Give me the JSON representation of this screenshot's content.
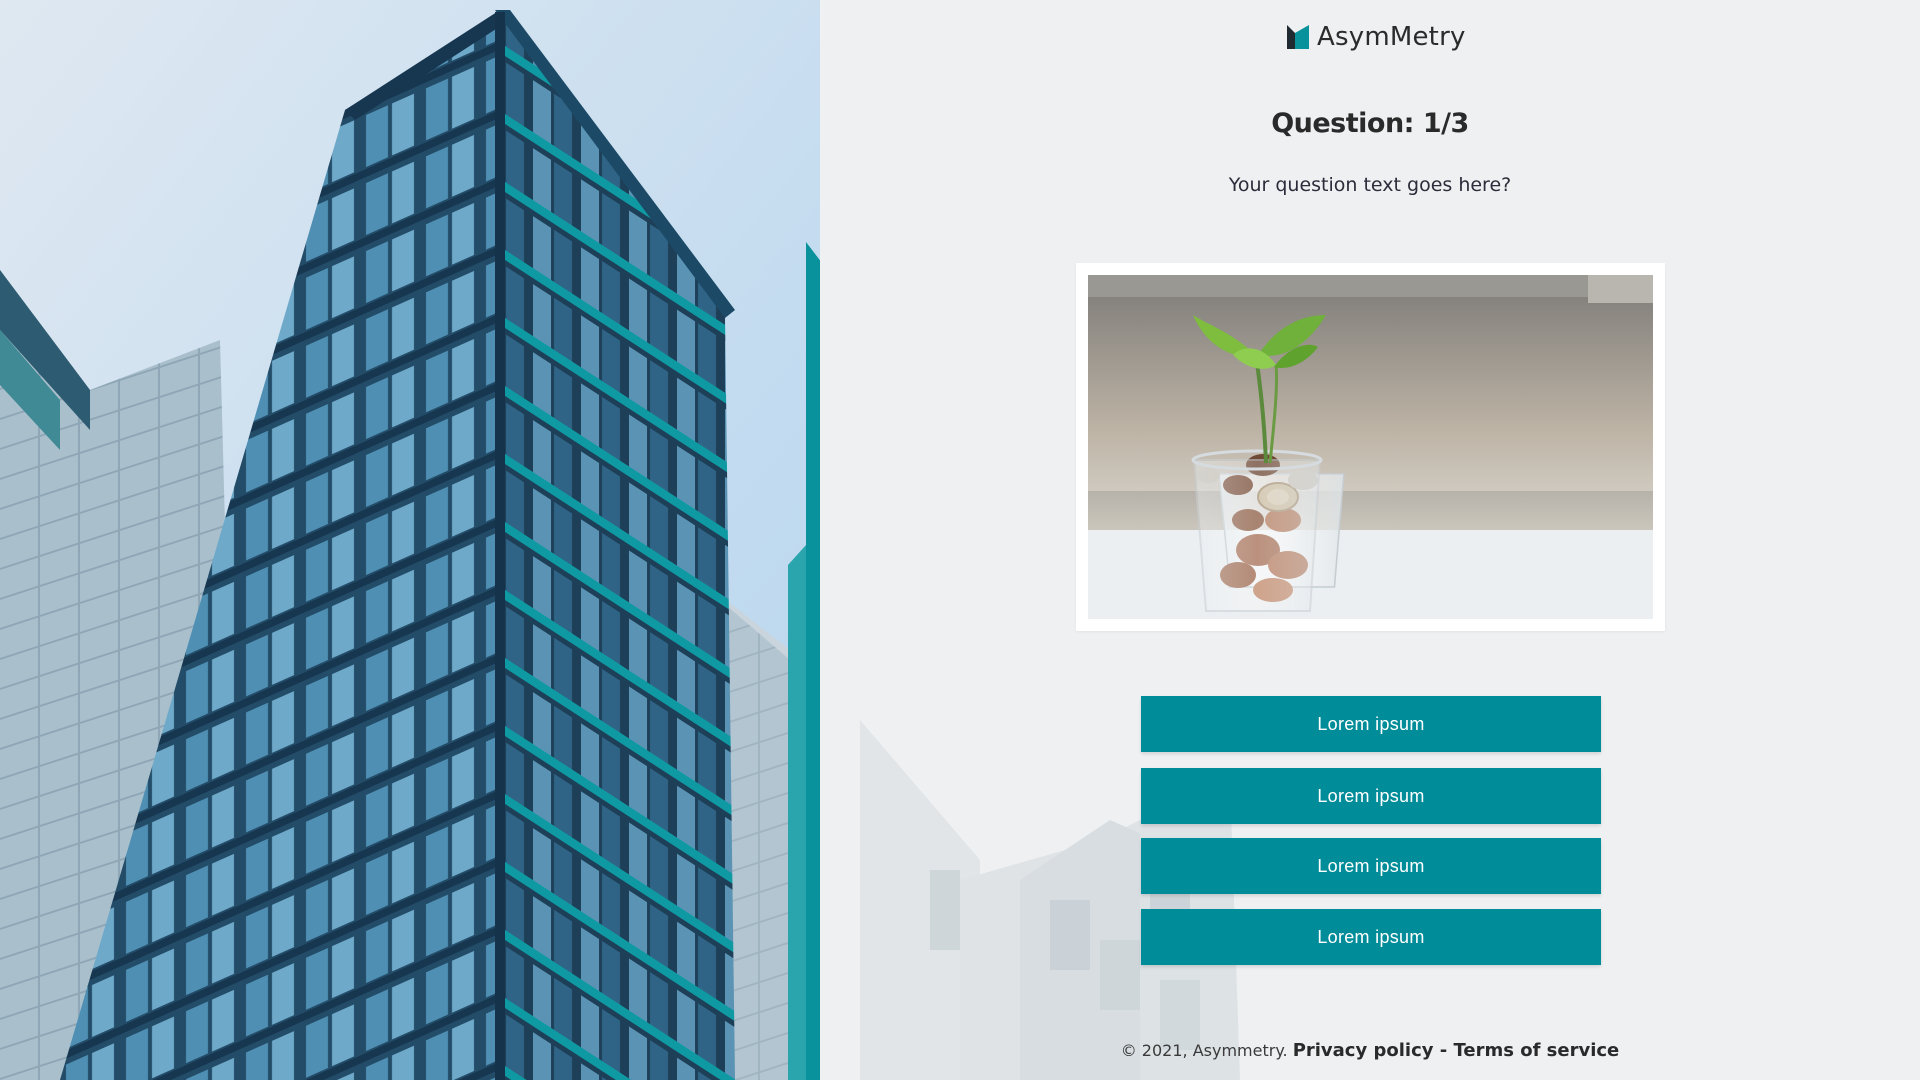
{
  "brand": {
    "name": "AsymMetry",
    "logo_icon": "asymmetry-logo-mark",
    "accent_color": "#008c99"
  },
  "quiz": {
    "title": "Question: 1/3",
    "question_text": "Your question text goes here?",
    "image_icon": "plant-in-coins-jar",
    "answers": [
      {
        "label": "Lorem ipsum"
      },
      {
        "label": "Lorem ipsum"
      },
      {
        "label": "Lorem ipsum"
      },
      {
        "label": "Lorem ipsum"
      }
    ]
  },
  "footer": {
    "copyright": "© 2021, Asymmetry.",
    "privacy_link": "Privacy policy",
    "separator": " - ",
    "terms_link": "Terms of service"
  }
}
